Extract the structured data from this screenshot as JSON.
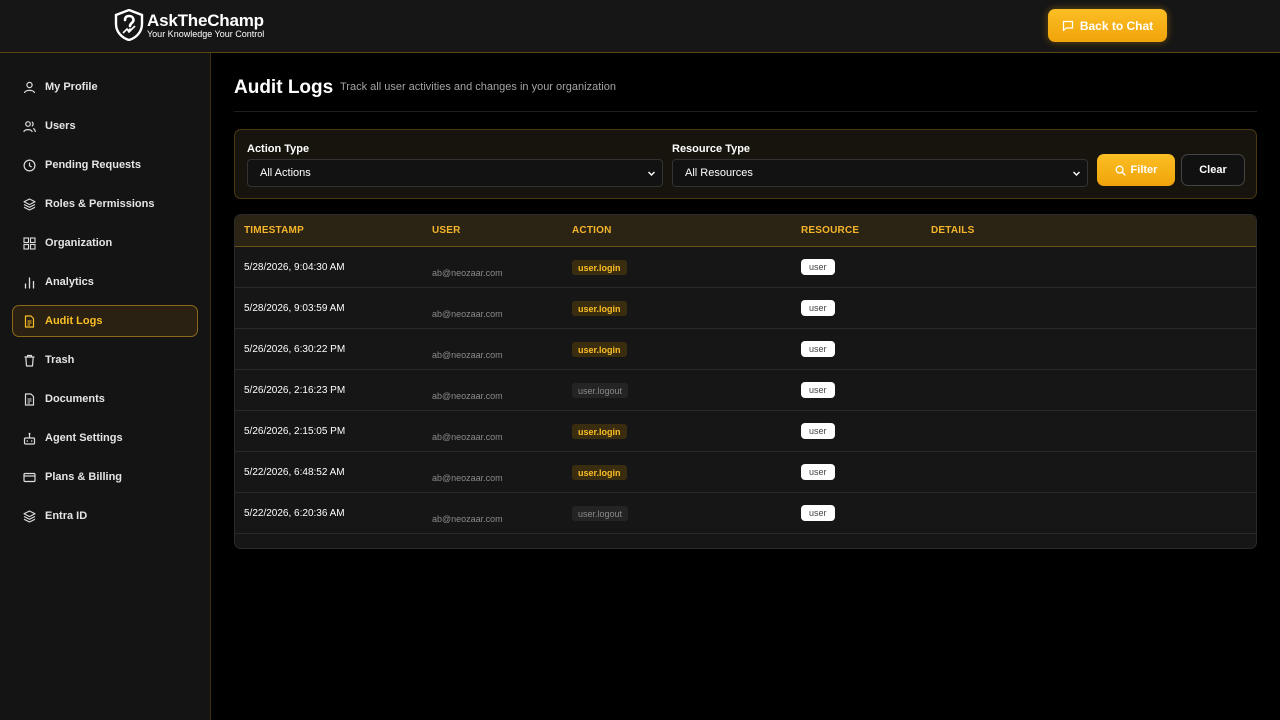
{
  "header": {
    "brand_ask": "AskThe",
    "brand_champ": "Champ",
    "tagline": "Your Knowledge Your Control",
    "back_label": "Back to Chat"
  },
  "sidebar": {
    "items": [
      {
        "label": "My Profile",
        "icon": "user-icon"
      },
      {
        "label": "Users",
        "icon": "users-icon"
      },
      {
        "label": "Pending Requests",
        "icon": "clock-icon"
      },
      {
        "label": "Roles & Permissions",
        "icon": "layers-icon"
      },
      {
        "label": "Organization",
        "icon": "grid-icon"
      },
      {
        "label": "Analytics",
        "icon": "bar-chart-icon"
      },
      {
        "label": "Audit Logs",
        "icon": "document-icon"
      },
      {
        "label": "Trash",
        "icon": "trash-icon"
      },
      {
        "label": "Documents",
        "icon": "file-icon"
      },
      {
        "label": "Agent Settings",
        "icon": "bot-icon"
      },
      {
        "label": "Plans & Billing",
        "icon": "credit-card-icon"
      },
      {
        "label": "Entra ID",
        "icon": "layers-icon"
      }
    ],
    "active": "Audit Logs"
  },
  "main": {
    "title": "Audit Logs",
    "subtitle": "Track all user activities and changes in your organization",
    "filters": {
      "action_label": "Action Type",
      "action_value": "All Actions",
      "resource_label": "Resource Type",
      "resource_value": "All Resources",
      "filter_label": "Filter",
      "clear_label": "Clear"
    },
    "table": {
      "columns": [
        "TIMESTAMP",
        "USER",
        "ACTION",
        "RESOURCE",
        "DETAILS"
      ],
      "rows": [
        {
          "timestamp": "5/28/2026, 9:04:30 AM",
          "user": "ab@neozaar.com",
          "action": "user.login",
          "resource": "user"
        },
        {
          "timestamp": "5/28/2026, 9:03:59 AM",
          "user": "ab@neozaar.com",
          "action": "user.login",
          "resource": "user"
        },
        {
          "timestamp": "5/26/2026, 6:30:22 PM",
          "user": "ab@neozaar.com",
          "action": "user.login",
          "resource": "user"
        },
        {
          "timestamp": "5/26/2026, 2:16:23 PM",
          "user": "ab@neozaar.com",
          "action": "user.logout",
          "resource": "user"
        },
        {
          "timestamp": "5/26/2026, 2:15:05 PM",
          "user": "ab@neozaar.com",
          "action": "user.login",
          "resource": "user"
        },
        {
          "timestamp": "5/22/2026, 6:48:52 AM",
          "user": "ab@neozaar.com",
          "action": "user.login",
          "resource": "user"
        },
        {
          "timestamp": "5/22/2026, 6:20:36 AM",
          "user": "ab@neozaar.com",
          "action": "user.logout",
          "resource": "user"
        }
      ]
    }
  },
  "colors": {
    "accent": "#fbbf24",
    "background": "#000000",
    "panel": "#161616"
  }
}
